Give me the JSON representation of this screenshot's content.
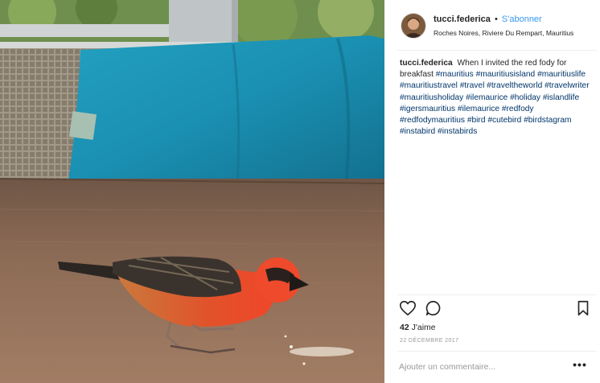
{
  "post": {
    "photo_alt": "red fody on a wooden table",
    "header": {
      "username": "tucci.federica",
      "separator": "•",
      "follow_label": "S'abonner",
      "location": "Roches Noires, Riviere Du Rempart, Mauritius"
    },
    "caption": {
      "username": "tucci.federica",
      "text": "When I invited the red fody for breakfast",
      "hashtags": [
        "#mauritius",
        "#mauritiusisland",
        "#mauritiuslife",
        "#mauritiustravel",
        "#travel",
        "#traveltheworld",
        "#travelwriter",
        "#mauritiusholiday",
        "#ilemaurice",
        "#holiday",
        "#islandlife",
        "#igersmauritius",
        "#ilemaurice",
        "#redfody",
        "#redfodymauritius",
        "#bird",
        "#cutebird",
        "#birdstagram",
        "#instabird",
        "#instabirds"
      ]
    },
    "actions": {
      "like_icon": "heart-icon",
      "comment_icon": "comment-bubble-icon",
      "save_icon": "bookmark-icon"
    },
    "likes": {
      "count": "42",
      "label": "J'aime"
    },
    "date": "22 DÉCEMBRE 2017",
    "comment": {
      "placeholder": "Ajouter un commentaire...",
      "options_label": "•••"
    },
    "colors": {
      "link": "#3897f0",
      "hashtag": "#003569",
      "text": "#262626",
      "muted": "#999999"
    }
  }
}
